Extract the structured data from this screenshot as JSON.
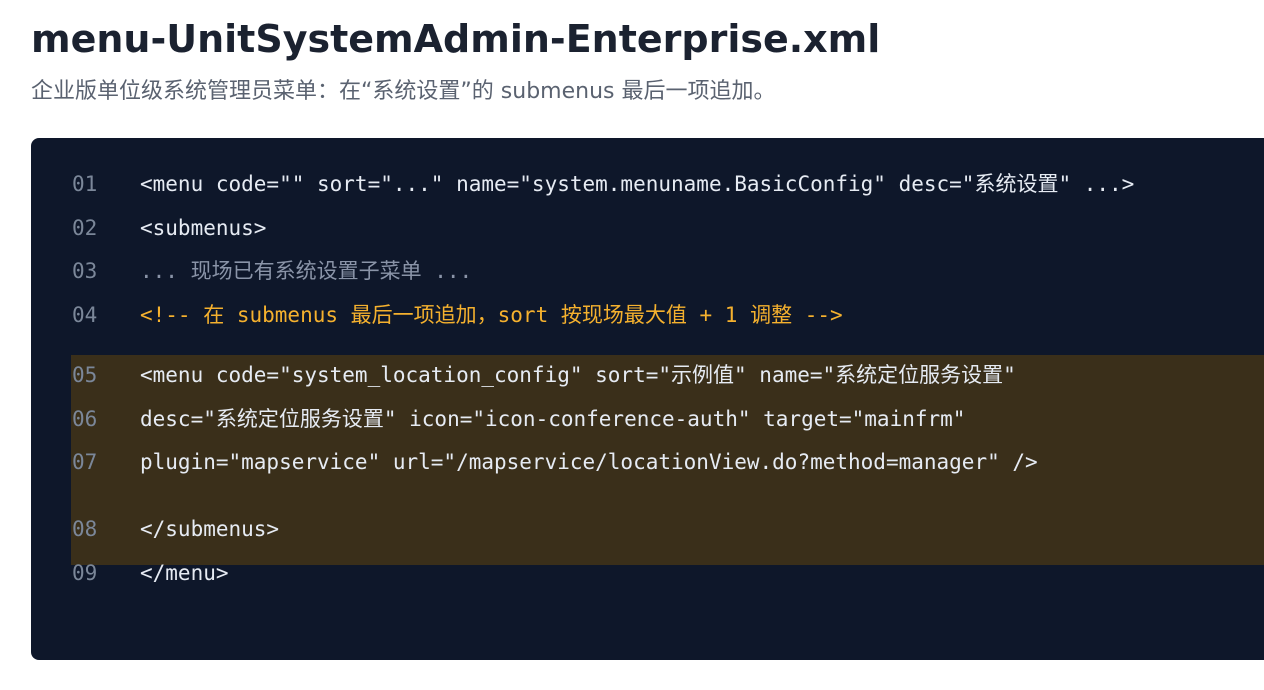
{
  "header": {
    "title": "menu-UnitSystemAdmin-Enterprise.xml",
    "subtitle": "企业版单位级系统管理员菜单：在“系统设置”的 submenus 最后一项追加。"
  },
  "code_block": {
    "lines": [
      {
        "number": "01",
        "text": "<menu code=\"\" sort=\"...\" name=\"system.menuname.BasicConfig\" desc=\"系统设置\" ...>"
      },
      {
        "number": "02",
        "text": "<submenus>"
      },
      {
        "number": "03",
        "text": "... 现场已有系统设置子菜单 ..."
      },
      {
        "number": "04",
        "text": "<!-- 在 submenus 最后一项追加，sort 按现场最大值 + 1 调整 -->"
      },
      {
        "number": "05",
        "text": "<menu code=\"system_location_config\" sort=\"示例值\" name=\"系统定位服务设置\""
      },
      {
        "number": "06",
        "text": "desc=\"系统定位服务设置\" icon=\"icon-conference-auth\" target=\"mainfrm\""
      },
      {
        "number": "07",
        "text": "plugin=\"mapservice\" url=\"/mapservice/locationView.do?method=manager\" />"
      },
      {
        "number": "08",
        "text": "</submenus>"
      },
      {
        "number": "09",
        "text": "</menu>"
      }
    ],
    "highlighted_lines": [
      "05",
      "06",
      "07",
      "08"
    ]
  },
  "colors": {
    "panel_background": "#0e172a",
    "highlight_background": "#3a2f1a",
    "code_text": "#e6ebf3",
    "line_number": "#7b8799",
    "muted_text": "#8a94a8",
    "comment_text": "#f5b12e"
  }
}
